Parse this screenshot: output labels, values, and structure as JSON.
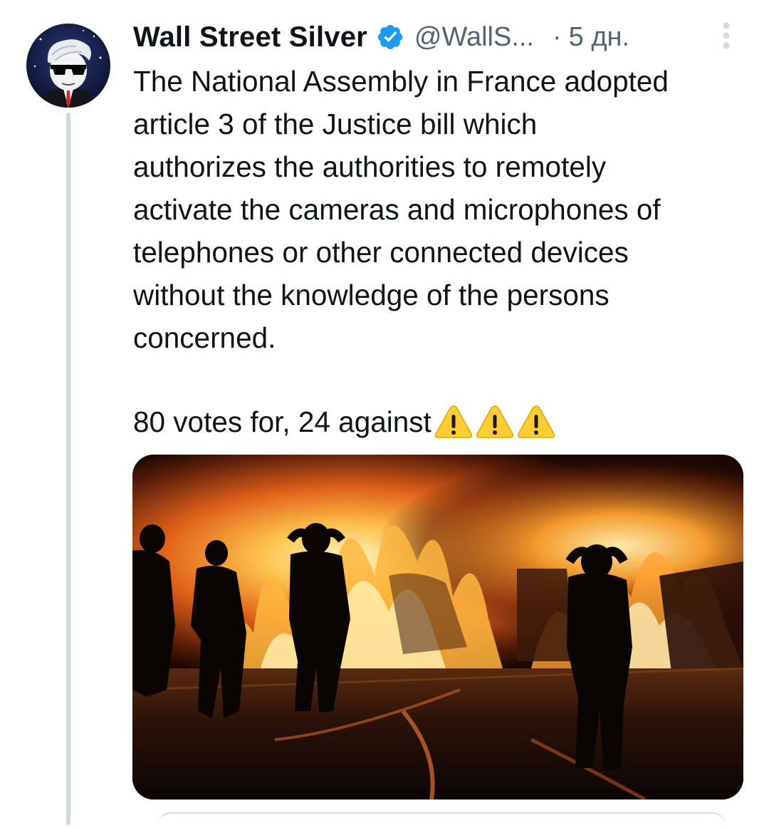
{
  "tweet": {
    "display_name": "Wall Street Silver",
    "handle": "@WallS...",
    "separator": "·",
    "time": "5 дн.",
    "text": "The National Assembly in France adopted\narticle 3 of the Justice bill which\nauthorizes the authorities to remotely\nactivate the cameras and microphones of\ntelephones or other connected devices\nwithout the knowledge of the persons\nconcerned.",
    "votes_text": "80 votes for, 24 against",
    "warning_emoji_count": 3,
    "verified": true
  },
  "icons": {
    "verified": "verified-badge-icon",
    "more": "more-vertical-icon",
    "warning": "warning-icon"
  },
  "colors": {
    "name": "#0f1419",
    "secondary": "#536471",
    "verified_blue": "#1d9bf0",
    "thread_line": "#cfd9de",
    "warning_yellow": "#ffcc33"
  }
}
